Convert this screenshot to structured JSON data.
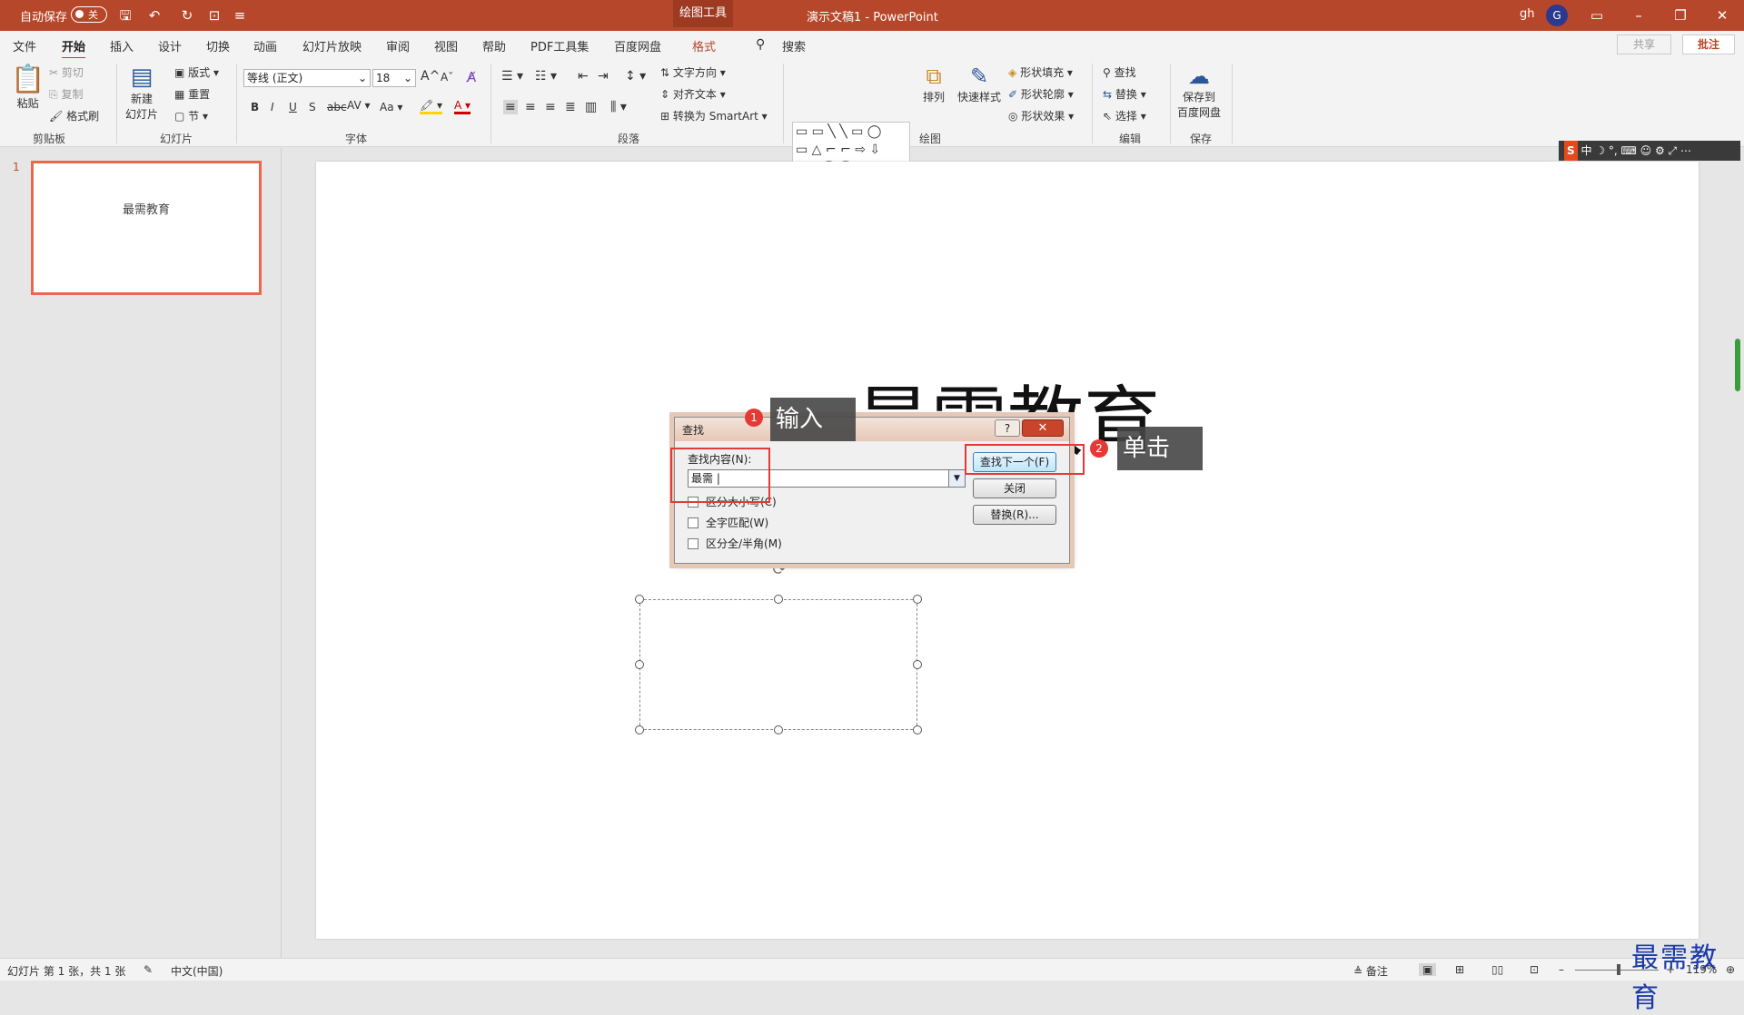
{
  "titlebar": {
    "autosave_label": "自动保存",
    "autosave_state": "关",
    "context_tab": "绘图工具",
    "doc_title": "演示文稿1 - PowerPoint",
    "user_name": "gh",
    "avatar_letter": "G",
    "qa_icons": [
      "save-icon",
      "undo-icon",
      "redo-icon",
      "present-icon",
      "customize-icon"
    ]
  },
  "menu": {
    "tabs": [
      "文件",
      "开始",
      "插入",
      "设计",
      "切换",
      "动画",
      "幻灯片放映",
      "审阅",
      "视图",
      "帮助",
      "PDF工具集",
      "百度网盘",
      "格式"
    ],
    "active": "开始",
    "search_placeholder": "搜索",
    "share": "共享",
    "comment": "批注"
  },
  "ribbon": {
    "clipboard": {
      "label": "剪贴板",
      "paste": "粘贴",
      "cut": "剪切",
      "copy": "复制",
      "format_painter": "格式刷"
    },
    "slides": {
      "label": "幻灯片",
      "new_slide_1": "新建",
      "new_slide_2": "幻灯片",
      "layout": "版式",
      "reset": "重置",
      "section": "节"
    },
    "font": {
      "label": "字体",
      "font_name": "等线 (正文)",
      "font_size": "18",
      "bold": "B",
      "italic": "I",
      "underline": "U",
      "shadow": "S",
      "strike": "abc",
      "spacing": "AV",
      "case": "Aa",
      "grow": "A",
      "shrink": "A"
    },
    "paragraph": {
      "label": "段落",
      "text_direction": "文字方向",
      "align_text": "对齐文本",
      "smartart": "转换为 SmartArt"
    },
    "drawing": {
      "label": "绘图",
      "arrange": "排列",
      "quick_styles": "快速样式",
      "shape_fill": "形状填充",
      "shape_outline": "形状轮廓",
      "shape_effects": "形状效果"
    },
    "editing": {
      "label": "编辑",
      "find": "查找",
      "replace": "替换",
      "select": "选择"
    },
    "save": {
      "label": "保存",
      "save_to_1": "保存到",
      "save_to_2": "百度网盘"
    }
  },
  "ime": {
    "logo": "S",
    "mode": "中"
  },
  "thumbnails": [
    {
      "number": "1",
      "text": "最需教育"
    }
  ],
  "slide": {
    "title": "最需教育"
  },
  "dialog": {
    "title": "查找",
    "help": "?",
    "close_x": "✕",
    "find_label": "查找内容(N):",
    "find_value": "最需",
    "match_case": "区分大小写(C)",
    "whole_word": "全字匹配(W)",
    "width_match": "区分全/半角(M)",
    "find_next": "查找下一个(F)",
    "close": "关闭",
    "replace": "替换(R)..."
  },
  "annotations": [
    {
      "number": "1",
      "text": "输入"
    },
    {
      "number": "2",
      "text": "单击"
    }
  ],
  "statusbar": {
    "slide_info": "幻灯片 第 1 张，共 1 张",
    "language": "中文(中国)",
    "notes": "备注",
    "zoom": "119%"
  },
  "watermark": "最需教育",
  "colors": {
    "accent": "#b7472a",
    "annotation_red": "#e53935",
    "callout_bg": "#464646",
    "watermark": "#1a3aa8"
  }
}
